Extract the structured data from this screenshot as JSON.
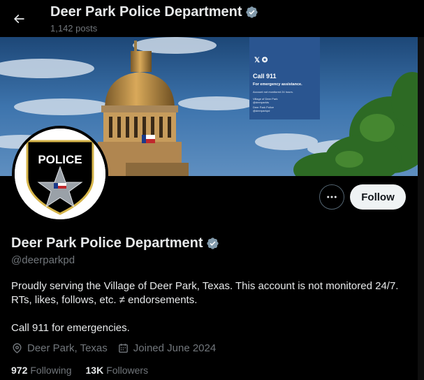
{
  "header": {
    "title": "Deer Park Police Department",
    "posts_count": "1,142 posts"
  },
  "banner": {
    "sign_headline": "Call 911",
    "sign_subline": "For emergency assistance.",
    "sign_note": "Account not monitored 24 hours.",
    "sign_org1": "Village of Deer Park",
    "sign_handle1": "@deerparkts",
    "sign_org2": "Deer Park Police",
    "sign_handle2": "@deerparkpd"
  },
  "profile": {
    "display_name": "Deer Park Police Department",
    "handle": "@deerparkpd",
    "bio_line1": "Proudly serving the Village of Deer Park, Texas. This account is not monitored 24/7.",
    "bio_line2": "RTs, likes, follows, etc. ≠ endorsements.",
    "bio_line3": "Call 911 for emergencies.",
    "location": "Deer Park, Texas",
    "joined": "Joined June 2024",
    "badge_text": "POLICE"
  },
  "actions": {
    "follow_label": "Follow"
  },
  "stats": {
    "following_count": "972",
    "following_label": "Following",
    "followers_count": "13K",
    "followers_label": "Followers"
  },
  "colors": {
    "background": "#000000",
    "text_primary": "#e7e9ea",
    "text_secondary": "#71767b",
    "verified_badge": "#829aab",
    "follow_button": "#eff3f4"
  },
  "icons": {
    "back": "arrow-left-icon",
    "verified": "verified-badge-icon",
    "more": "more-horizontal-icon",
    "location": "location-pin-icon",
    "calendar": "calendar-icon"
  }
}
